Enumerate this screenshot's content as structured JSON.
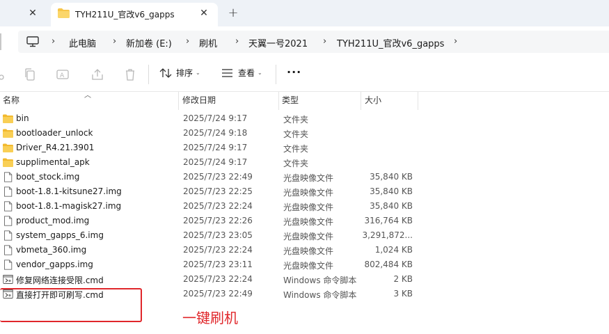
{
  "tabbar": {
    "active_tab_title": "TYH211U_官改v6_gapps",
    "close_glyph": "✕",
    "add_glyph": "+"
  },
  "address": {
    "crumbs": [
      "此电脑",
      "新加卷 (E:)",
      "刷机",
      "天翼一号2021",
      "TYH211U_官改v6_gapps"
    ],
    "separator": "›"
  },
  "toolbar": {
    "sort_label": "排序",
    "view_label": "查看",
    "more_label": "···"
  },
  "columns": {
    "name": "名称",
    "modified": "修改日期",
    "type": "类型",
    "size": "大小"
  },
  "files": [
    {
      "name": "bin",
      "modified": "2025/7/24 9:17",
      "type": "文件夹",
      "size": "",
      "kind": "folder"
    },
    {
      "name": "bootloader_unlock",
      "modified": "2025/7/24 9:18",
      "type": "文件夹",
      "size": "",
      "kind": "folder"
    },
    {
      "name": "Driver_R4.21.3901",
      "modified": "2025/7/24 9:17",
      "type": "文件夹",
      "size": "",
      "kind": "folder"
    },
    {
      "name": "supplimental_apk",
      "modified": "2025/7/24 9:17",
      "type": "文件夹",
      "size": "",
      "kind": "folder"
    },
    {
      "name": "boot_stock.img",
      "modified": "2025/7/23 22:49",
      "type": "光盘映像文件",
      "size": "35,840 KB",
      "kind": "file"
    },
    {
      "name": "boot-1.8.1-kitsune27.img",
      "modified": "2025/7/23 22:25",
      "type": "光盘映像文件",
      "size": "35,840 KB",
      "kind": "file"
    },
    {
      "name": "boot-1.8.1-magisk27.img",
      "modified": "2025/7/23 22:24",
      "type": "光盘映像文件",
      "size": "35,840 KB",
      "kind": "file"
    },
    {
      "name": "product_mod.img",
      "modified": "2025/7/23 22:26",
      "type": "光盘映像文件",
      "size": "316,764 KB",
      "kind": "file"
    },
    {
      "name": "system_gapps_6.img",
      "modified": "2025/7/23 23:05",
      "type": "光盘映像文件",
      "size": "3,291,872...",
      "kind": "file"
    },
    {
      "name": "vbmeta_360.img",
      "modified": "2025/7/23 22:24",
      "type": "光盘映像文件",
      "size": "1,024 KB",
      "kind": "file"
    },
    {
      "name": "vendor_gapps.img",
      "modified": "2025/7/23 23:11",
      "type": "光盘映像文件",
      "size": "802,484 KB",
      "kind": "file"
    },
    {
      "name": "修复网络连接受限.cmd",
      "modified": "2025/7/23 22:24",
      "type": "Windows 命令脚本",
      "size": "2 KB",
      "kind": "cmd"
    },
    {
      "name": "直接打开即可刷写.cmd",
      "modified": "2025/7/23 22:49",
      "type": "Windows 命令脚本",
      "size": "3 KB",
      "kind": "cmd"
    }
  ],
  "annotation": {
    "text": "一键刷机",
    "color": "#e0262a"
  },
  "colors": {
    "folder": "#f7c548",
    "accent": "#0067c0"
  }
}
